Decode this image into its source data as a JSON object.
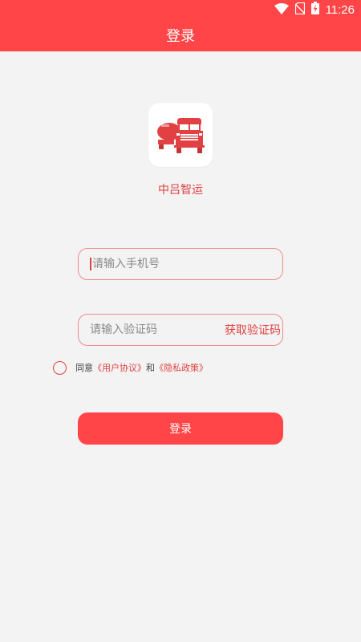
{
  "status_bar": {
    "time": "11:26"
  },
  "header": {
    "title": "登录"
  },
  "app": {
    "name": "中吕智运",
    "logo_icon": "tanker-truck-icon"
  },
  "form": {
    "phone_placeholder": "请输入手机号",
    "phone_value": "",
    "code_placeholder": "请输入验证码",
    "code_value": "",
    "get_code_label": "获取验证码"
  },
  "agreement": {
    "checked": false,
    "prefix": "同意",
    "user_agreement": "《用户协议》",
    "conjunction": "和",
    "privacy_policy": "《隐私政策》"
  },
  "login_button": {
    "label": "登录"
  },
  "colors": {
    "accent": "#ff4547",
    "accent_text": "#e24143",
    "background": "#f3f3f3"
  }
}
